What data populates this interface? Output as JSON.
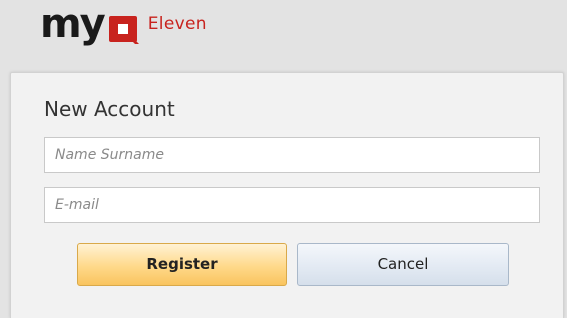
{
  "brand": {
    "my_text": "my",
    "eleven_text": "Eleven",
    "colors": {
      "dark": "#1a1a1a",
      "red": "#c8231e"
    },
    "icon": "q-logo-icon"
  },
  "form": {
    "title": "New Account",
    "name_field": {
      "placeholder": "Name Surname",
      "value": ""
    },
    "email_field": {
      "placeholder": "E-mail",
      "value": ""
    },
    "register_label": "Register",
    "cancel_label": "Cancel"
  },
  "colors": {
    "register_accent": "#f9c45f",
    "cancel_accent": "#d5dfeb"
  }
}
